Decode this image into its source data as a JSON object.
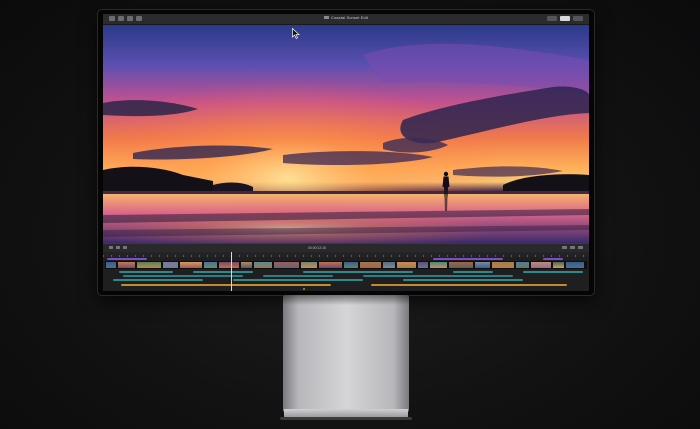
{
  "window": {
    "title": "Coastal Sunset Edit"
  },
  "titlebar_right": {
    "segments": [
      "",
      "",
      ""
    ]
  },
  "viewer": {
    "left_label": "",
    "right_label": ""
  },
  "toolbar": {
    "timecode": "00:00:12:15"
  },
  "colors": {
    "screen_bg": "#1c1c1e",
    "clip_teal": "#2f8a8c",
    "clip_purple": "#6b3fb0",
    "audio_orange": "#c58a2b",
    "playhead": "#d9d9dc"
  },
  "icons": [
    "lib-icon",
    "import-icon",
    "keyword-icon",
    "film-icon",
    "play-icon",
    "cursor-icon"
  ]
}
